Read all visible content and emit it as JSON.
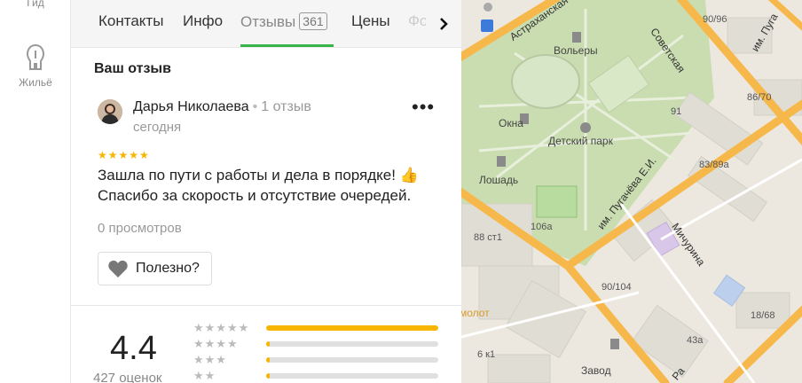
{
  "rail": {
    "gid_label": "Гид",
    "home_label": "Жильё"
  },
  "tabs": [
    {
      "label": "Контакты"
    },
    {
      "label": "Инфо"
    },
    {
      "label": "Отзывы",
      "count": "361"
    },
    {
      "label": "Цены"
    },
    {
      "label": "Фо"
    }
  ],
  "review": {
    "section_title": "Ваш отзыв",
    "author": "Дарья Николаева",
    "author_reviews": "1 отзыв",
    "date": "сегодня",
    "stars": "★★★★★",
    "text_line1": "Зашла по пути с работы и дела в порядке! 👍",
    "text_line2": "Спасибо за скорость и отсутствие очередей.",
    "views": "0 просмотров",
    "useful_label": "Полезно?"
  },
  "summary": {
    "score": "4.4",
    "count": "427 оценок",
    "distribution": [
      {
        "stars": "★★★★★",
        "fraction": 1.0
      },
      {
        "stars": "★★★★",
        "fraction": 0.02
      },
      {
        "stars": "★★★",
        "fraction": 0.02
      },
      {
        "stars": "★★",
        "fraction": 0.02
      }
    ]
  },
  "map": {
    "labels": {
      "volery": "Вольеры",
      "okna": "Окна",
      "detsky_park": "Детский парк",
      "loshad": "Лошадь",
      "n91": "91",
      "n90_96": "90/96",
      "n86_70": "86/70",
      "n83_89a": "83/89а",
      "n106a": "106а",
      "n88_st1": "88 ст1",
      "n90_104": "90/104",
      "n18_68": "18/68",
      "n43a": "43а",
      "n6_k1": "6 к1",
      "zavod": "Завод",
      "molot": "молот"
    },
    "streets": {
      "astrakhanskaya": "Астраханская",
      "sovetskaya": "Советская",
      "pugacheva": "им. Пугачёва Е.И.",
      "michurina": "Мичурина",
      "pugacheva2": "им. Пуга",
      "ra": "Ра"
    }
  },
  "colors": {
    "accent": "#3ab54a",
    "star": "#f7b500",
    "road": "#f6b84a",
    "park": "#c9ddb0"
  }
}
